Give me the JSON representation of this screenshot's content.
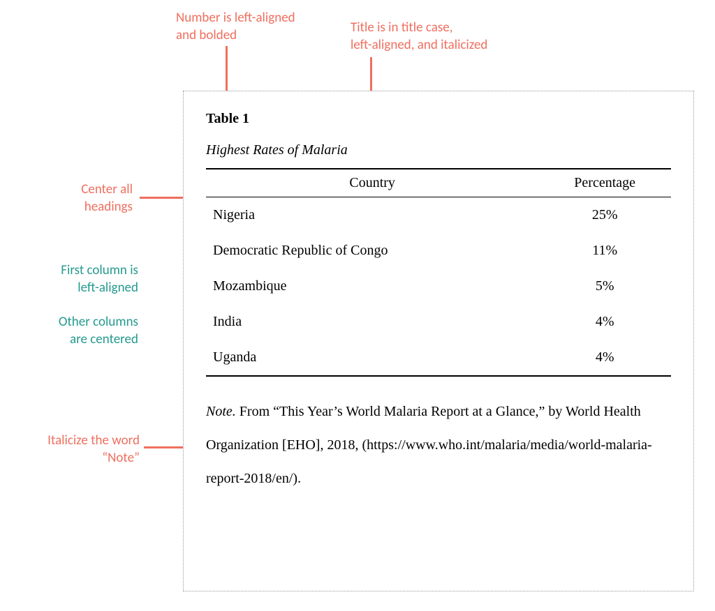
{
  "annotations": {
    "number_bold": "Number is left-aligned\nand bolded",
    "title_case": "Title is in title case,\nleft-aligned, and italicized",
    "center_headings": "Center all\nheadings",
    "first_col": "First column is\nleft-aligned",
    "other_cols": "Other columns\nare centered",
    "italicize_note": "Italicize the word\n“Note”"
  },
  "table": {
    "number": "Table 1",
    "title": "Highest Rates of Malaria",
    "headers": {
      "country": "Country",
      "percentage": "Percentage"
    },
    "rows": [
      {
        "country": "Nigeria",
        "percentage": "25%"
      },
      {
        "country": "Democratic Republic of Congo",
        "percentage": "11%"
      },
      {
        "country": "Mozambique",
        "percentage": "5%"
      },
      {
        "country": "India",
        "percentage": "4%"
      },
      {
        "country": "Uganda",
        "percentage": "4%"
      }
    ],
    "note": {
      "label": "Note.",
      "text": " From “This Year’s World Malaria Report at a Glance,” by World Health Organization [EHO], 2018, (https://www.who.int/malaria/media/world-malaria-report-2018/en/)."
    }
  }
}
